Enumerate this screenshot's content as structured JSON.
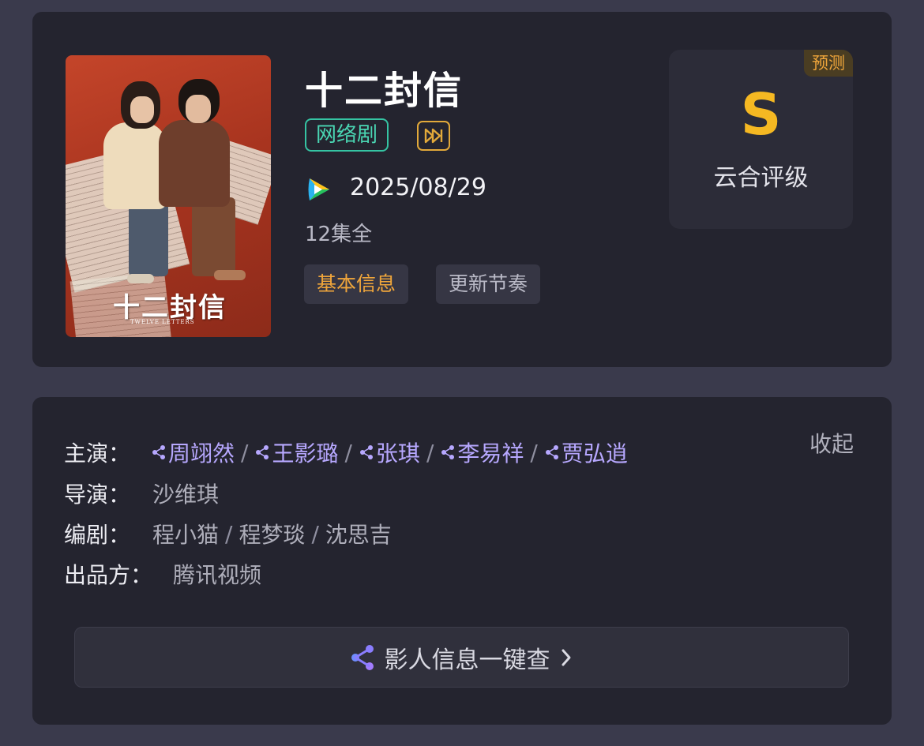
{
  "show": {
    "title": "十二封信",
    "genre": "网络剧",
    "release_date": "2025/08/29",
    "episodes": "12集全",
    "poster": {
      "title": "十二封信",
      "subtitle": "TWELVE LETTERS"
    }
  },
  "icons": {
    "fast_forward": "fast-forward-icon",
    "platform": "tencent-video-icon",
    "cast_link": "share-node-icon",
    "chevron": "chevron-right-icon"
  },
  "tabs": [
    {
      "label": "基本信息",
      "active": true
    },
    {
      "label": "更新节奏",
      "active": false
    }
  ],
  "rating": {
    "badge": "预测",
    "grade": "S",
    "label": "云合评级"
  },
  "details": {
    "collapse_label": "收起",
    "cast_label": "主演：",
    "cast": [
      "周翊然",
      "王影璐",
      "张琪",
      "李易祥",
      "贾弘逍"
    ],
    "director_label": "导演：",
    "director": "沙维琪",
    "writer_label": "编剧：",
    "writers": [
      "程小猫",
      "程梦琰",
      "沈思吉"
    ],
    "producer_label": "出品方：",
    "producer": "腾讯视频",
    "separator": "/",
    "cta_label": "影人信息一键查"
  },
  "colors": {
    "background": "#3a3a4c",
    "card": "#24242f",
    "accent_orange": "#f0a63b",
    "grade_yellow": "#f5b822",
    "genre_green": "#35c4a3",
    "cast_link": "#b7a8ff"
  }
}
